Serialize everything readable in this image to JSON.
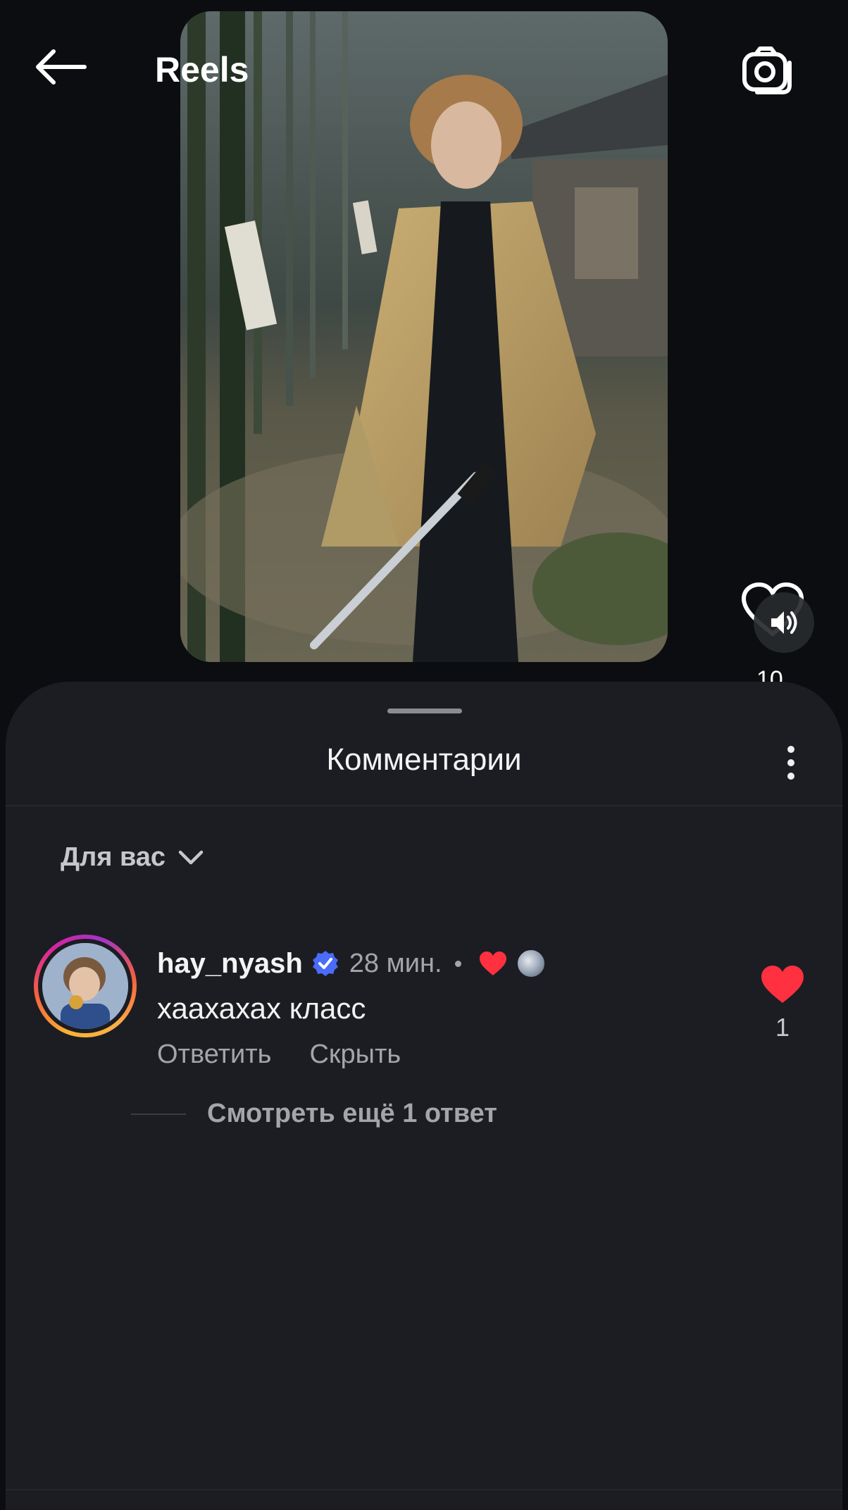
{
  "header": {
    "title": "Reels"
  },
  "reel": {
    "likes_partial": "10"
  },
  "sheet": {
    "title": "Комментарии",
    "filter_label": "Для вас"
  },
  "comment": {
    "username": "hay_nyash",
    "time": "28 мин.",
    "text": "хаахахах класс",
    "reply_label": "Ответить",
    "hide_label": "Скрыть",
    "like_count": "1",
    "view_replies": "Смотреть ещё 1 ответ"
  },
  "colors": {
    "background": "#0b0d11",
    "sheet": "#1b1d22",
    "like_red": "#ff3040",
    "verified_blue": "#4a6cf7",
    "secondary_text": "#a3a5aa"
  }
}
